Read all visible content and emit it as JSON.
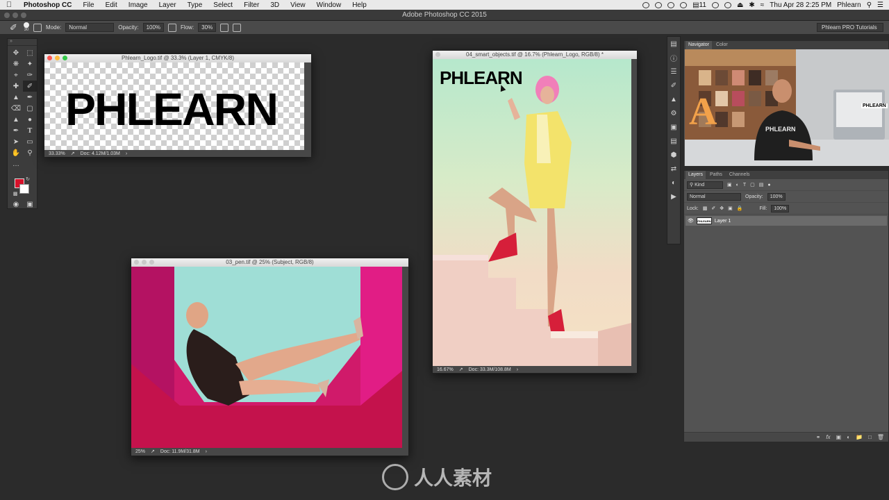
{
  "menubar": {
    "apple": "",
    "items": [
      "Photoshop CC",
      "File",
      "Edit",
      "Image",
      "Layer",
      "Type",
      "Select",
      "Filter",
      "3D",
      "View",
      "Window",
      "Help"
    ],
    "battery": "11",
    "clock": "Thu Apr 28  2:25 PM",
    "user": "Phlearn"
  },
  "app": {
    "title": "Adobe Photoshop CC 2015"
  },
  "options": {
    "brush_size": "30",
    "mode_label": "Mode:",
    "mode_value": "Normal",
    "opacity_label": "Opacity:",
    "opacity_value": "100%",
    "flow_label": "Flow:",
    "flow_value": "30%",
    "workspace": "Phlearn PRO Tutorials"
  },
  "colors": {
    "foreground": "#d6112a",
    "background": "#ffffff"
  },
  "docs": [
    {
      "title": "Phlearn_Logo.tif @ 33.3% (Layer 1, CMYK/8)",
      "zoom": "33.33%",
      "doc": "Doc: 4.12M/1.03M",
      "logo": "PHLEARN"
    },
    {
      "title": "03_pen.tif @ 25% (Subject, RGB/8)",
      "zoom": "25%",
      "doc": "Doc: 11.9M/31.8M"
    },
    {
      "title": "04_smart_objects.tif @ 16.7% (Phlearn_Logo, RGB/8) *",
      "zoom": "16.67%",
      "doc": "Doc: 33.3M/108.8M",
      "logo": "PHLEARN"
    }
  ],
  "navigator": {
    "tabs": [
      "Navigator",
      "Color"
    ],
    "sign_letter": "A",
    "shirt_text": "PHLEARN",
    "monitor_text": "PHLEARN"
  },
  "layers": {
    "tabs": [
      "Layers",
      "Paths",
      "Channels"
    ],
    "kind_label": "Kind",
    "blend_mode": "Normal",
    "opacity_label": "Opacity:",
    "opacity_value": "100%",
    "lock_label": "Lock:",
    "fill_label": "Fill:",
    "fill_value": "100%",
    "items": [
      {
        "name": "Layer 1",
        "thumb_text": "PHLEARN"
      }
    ]
  },
  "watermark": {
    "text": "人人素材"
  }
}
